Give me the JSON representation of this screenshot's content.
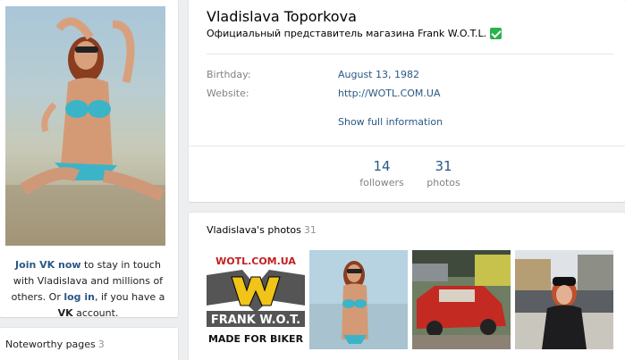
{
  "profile": {
    "name": "Vladislava Toporkova",
    "status": "Официальный представитель магазина Frank W.O.T.L.",
    "info": [
      {
        "label": "Birthday:",
        "value": "August 13, 1982"
      },
      {
        "label": "Website:",
        "value": "http://WOTL.COM.UA"
      }
    ],
    "show_full": "Show full information",
    "counters": [
      {
        "number": "14",
        "label": "followers"
      },
      {
        "number": "31",
        "label": "photos"
      }
    ]
  },
  "join": {
    "join_vk": "Join VK now",
    "text_1": " to stay in touch with Vladislava and millions of others. Or ",
    "log_in": "log in",
    "text_2": ", if you have a ",
    "vk": "VK",
    "text_3": " account."
  },
  "noteworthy": {
    "title": "Noteworthy pages",
    "count": "3"
  },
  "photos": {
    "title": "Vladislava's photos",
    "count": "31",
    "logo_text_top": "WOTL.COM.UA",
    "logo_text_mid": "FRANK W.O.T.",
    "logo_text_bottom": "MADE FOR BIKER"
  },
  "colors": {
    "link": "#2a5885",
    "muted": "#828282",
    "background": "#edeef0",
    "verified": "#2bb24c"
  }
}
